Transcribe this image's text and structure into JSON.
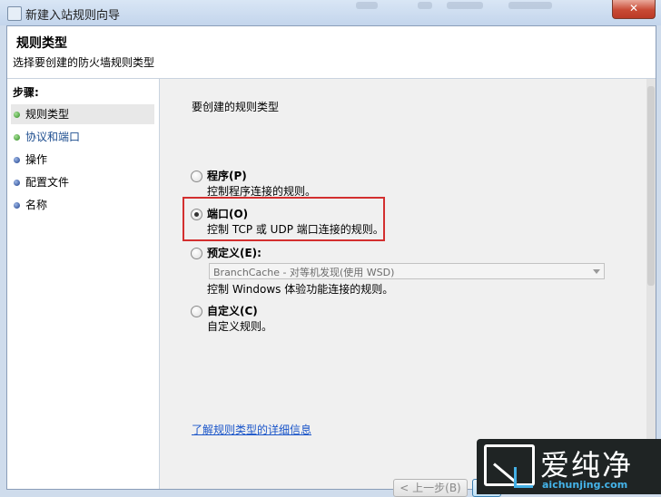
{
  "window": {
    "title": "新建入站规则向导",
    "close_label": "✕"
  },
  "header": {
    "title": "规则类型",
    "subtitle": "选择要创建的防火墙规则类型"
  },
  "steps": {
    "label": "步骤:",
    "items": [
      {
        "label": "规则类型",
        "state": "current"
      },
      {
        "label": "协议和端口",
        "state": "done"
      },
      {
        "label": "操作",
        "state": "pending"
      },
      {
        "label": "配置文件",
        "state": "pending"
      },
      {
        "label": "名称",
        "state": "pending"
      }
    ]
  },
  "main": {
    "question": "要创建的规则类型",
    "options": [
      {
        "label": "程序(P)",
        "desc": "控制程序连接的规则。",
        "selected": false
      },
      {
        "label": "端口(O)",
        "desc": "控制 TCP 或 UDP 端口连接的规则。",
        "selected": true
      },
      {
        "label": "预定义(E):",
        "desc": "控制 Windows 体验功能连接的规则。",
        "selected": false
      },
      {
        "label": "自定义(C)",
        "desc": "自定义规则。",
        "selected": false
      }
    ],
    "predefined_select": "BranchCache - 对等机发现(使用 WSD)",
    "learn_more": "了解规则类型的详细信息",
    "buttons": {
      "back": "< 上一步(B)",
      "next": ""
    }
  },
  "watermark": {
    "brand": "爱纯净",
    "site": "aichunjing.com"
  },
  "colors": {
    "highlight": "#d32f2f",
    "link": "#1a55c9",
    "close": "#c84a35"
  }
}
